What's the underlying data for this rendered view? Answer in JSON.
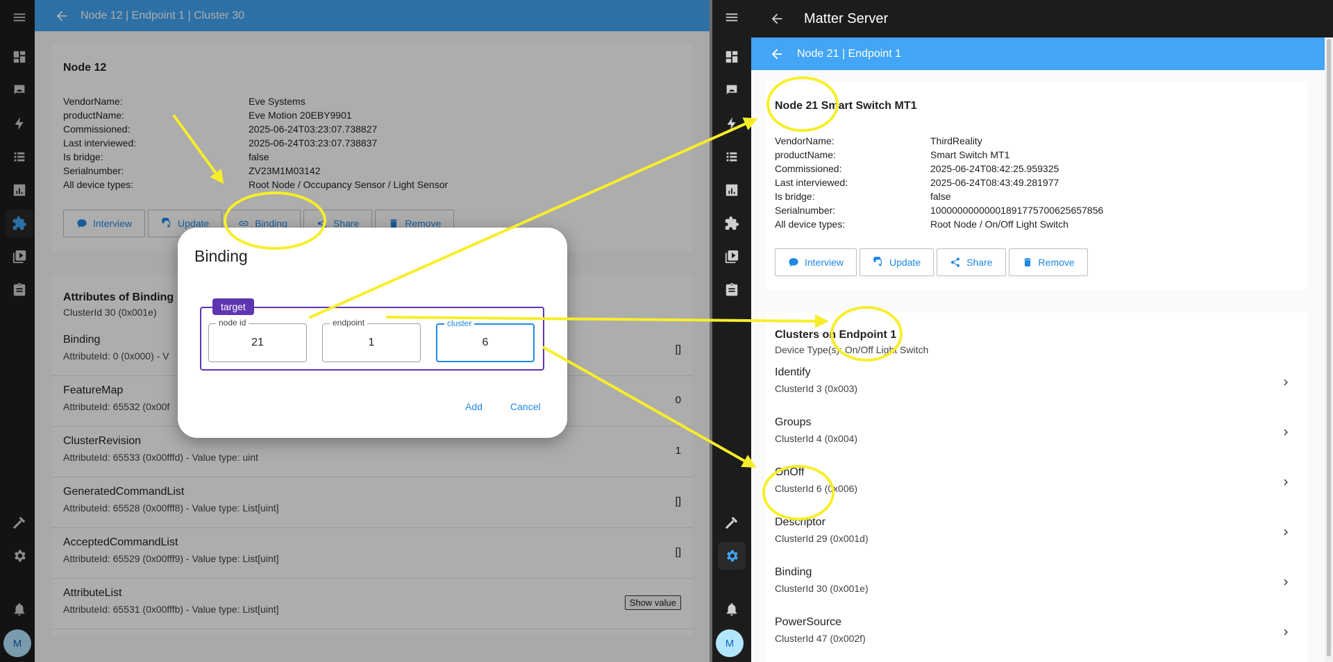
{
  "left": {
    "appbar_title": "Node 12 | Endpoint 1 | Cluster 30",
    "node_card": {
      "title": "Node 12",
      "rows": [
        {
          "k": "VendorName:",
          "v": "Eve Systems"
        },
        {
          "k": "productName:",
          "v": "Eve Motion 20EBY9901"
        },
        {
          "k": "Commissioned:",
          "v": "2025-06-24T03:23:07.738827"
        },
        {
          "k": "Last interviewed:",
          "v": "2025-06-24T03:23:07.738837"
        },
        {
          "k": "Is bridge:",
          "v": "false"
        },
        {
          "k": "Serialnumber:",
          "v": "ZV23M1M03142"
        },
        {
          "k": "All device types:",
          "v": "Root Node / Occupancy Sensor / Light Sensor"
        }
      ],
      "buttons": [
        "Interview",
        "Update",
        "Binding",
        "Share",
        "Remove"
      ]
    },
    "attributes_card": {
      "title": "Attributes of Binding",
      "subtitle": "ClusterId 30 (0x001e)",
      "rows": [
        {
          "name": "Binding",
          "sub": "AttributeId: 0 (0x000) - V",
          "value": "[]"
        },
        {
          "name": "FeatureMap",
          "sub": "AttributeId: 65532 (0x00f",
          "value": "0"
        },
        {
          "name": "ClusterRevision",
          "sub": "AttributeId: 65533 (0x00fffd) - Value type: uint",
          "value": "1"
        },
        {
          "name": "GeneratedCommandList",
          "sub": "AttributeId: 65528 (0x00fff8) - Value type: List[uint]",
          "value": "[]"
        },
        {
          "name": "AcceptedCommandList",
          "sub": "AttributeId: 65529 (0x00fff9) - Value type: List[uint]",
          "value": "[]"
        },
        {
          "name": "AttributeList",
          "sub": "AttributeId: 65531 (0x00fffb) - Value type: List[uint]",
          "value": "Show value"
        }
      ]
    },
    "avatar": "M"
  },
  "dialog": {
    "title": "Binding",
    "legend": "target",
    "fields": [
      {
        "label": "node id",
        "value": "21"
      },
      {
        "label": "endpoint",
        "value": "1"
      },
      {
        "label": "cluster",
        "value": "6"
      }
    ],
    "add": "Add",
    "cancel": "Cancel"
  },
  "right": {
    "top_title": "Matter Server",
    "sub_title": "Node 21 | Endpoint 1",
    "node_card": {
      "title": "Node 21 Smart Switch MT1",
      "rows": [
        {
          "k": "VendorName:",
          "v": "ThirdReality"
        },
        {
          "k": "productName:",
          "v": "Smart Switch MT1"
        },
        {
          "k": "Commissioned:",
          "v": "2025-06-24T08:42:25.959325"
        },
        {
          "k": "Last interviewed:",
          "v": "2025-06-24T08:43:49.281977"
        },
        {
          "k": "Is bridge:",
          "v": "false"
        },
        {
          "k": "Serialnumber:",
          "v": "10000000000001891775700625657856"
        },
        {
          "k": "All device types:",
          "v": "Root Node / On/Off Light Switch"
        }
      ],
      "buttons": [
        "Interview",
        "Update",
        "Share",
        "Remove"
      ]
    },
    "clusters_card": {
      "title": "Clusters on Endpoint 1",
      "subtitle": "Device Type(s): On/Off Light Switch",
      "rows": [
        {
          "name": "Identify",
          "sub": "ClusterId 3 (0x003)"
        },
        {
          "name": "Groups",
          "sub": "ClusterId 4 (0x004)"
        },
        {
          "name": "OnOff",
          "sub": "ClusterId 6 (0x006)"
        },
        {
          "name": "Descriptor",
          "sub": "ClusterId 29 (0x001d)"
        },
        {
          "name": "Binding",
          "sub": "ClusterId 30 (0x001e)"
        },
        {
          "name": "PowerSource",
          "sub": "ClusterId 47 (0x002f)"
        }
      ]
    },
    "avatar": "M"
  }
}
